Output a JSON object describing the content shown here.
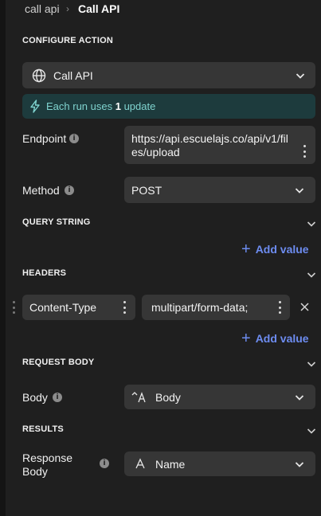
{
  "breadcrumb": {
    "parent": "call api",
    "separator": "›",
    "current": "Call API"
  },
  "sections": {
    "configure_action": "CONFIGURE ACTION",
    "query_string": "QUERY STRING",
    "headers": "HEADERS",
    "request_body": "REQUEST BODY",
    "results": "RESULTS"
  },
  "action_select": {
    "value": "Call API",
    "icon": "globe-icon"
  },
  "notice": {
    "prefix": "Each run uses ",
    "count": "1",
    "suffix": " update",
    "icon": "lightning-icon"
  },
  "endpoint": {
    "label": "Endpoint",
    "value_line1": "https://api.escuelajs.co/api/v1/fil",
    "value_line2": "es/upload"
  },
  "method": {
    "label": "Method",
    "value": "POST"
  },
  "query_string": {
    "add_label": "Add value"
  },
  "headers": {
    "rows": [
      {
        "key": "Content-Type",
        "value": "multipart/form-data;"
      }
    ],
    "add_label": "Add value"
  },
  "body": {
    "label": "Body",
    "value": "Body"
  },
  "response_body": {
    "label_line1": "Response",
    "label_line2": "Body",
    "value": "Name"
  },
  "colors": {
    "accent": "#6d8cf0",
    "notice_bg": "#1d3b3d",
    "notice_text": "#7fd3cf"
  }
}
